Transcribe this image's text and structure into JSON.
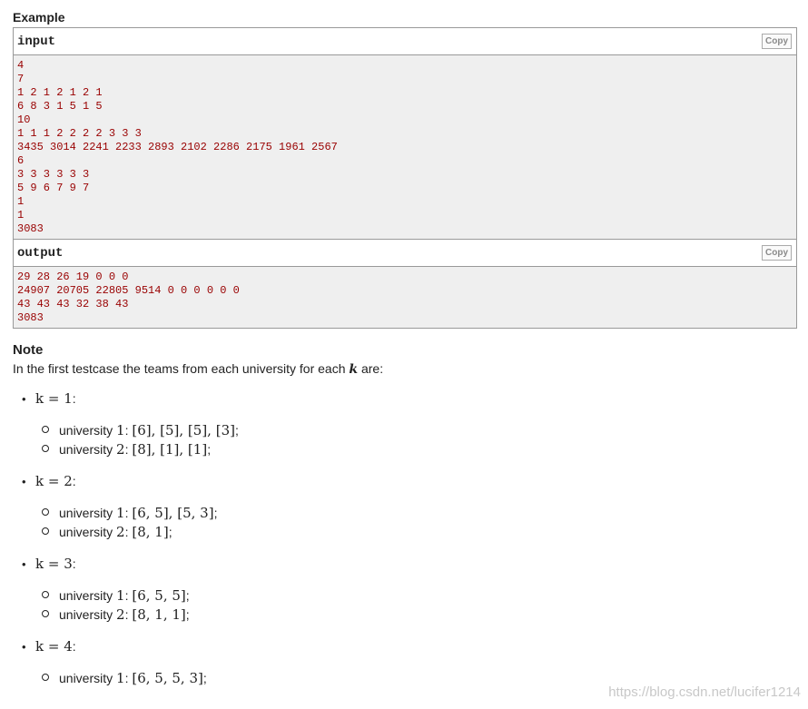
{
  "example": {
    "title": "Example",
    "input_label": "input",
    "output_label": "output",
    "copy_label": "Copy",
    "input_lines": [
      "4",
      "7",
      "1 2 1 2 1 2 1",
      "6 8 3 1 5 1 5",
      "10",
      "1 1 1 2 2 2 2 3 3 3",
      "3435 3014 2241 2233 2893 2102 2286 2175 1961 2567",
      "6",
      "3 3 3 3 3 3",
      "5 9 6 7 9 7",
      "1",
      "1",
      "3083"
    ],
    "output_lines": [
      "29 28 26 19 0 0 0",
      "24907 20705 22805 9514 0 0 0 0 0 0",
      "43 43 43 32 38 43",
      "3083"
    ]
  },
  "note": {
    "title": "Note",
    "intro_before": "In the first testcase the teams from each university for each ",
    "intro_var": "k",
    "intro_after": " are:",
    "cases": [
      {
        "k": "k = 1",
        "items": [
          {
            "label": "university ",
            "num": "1",
            "value": "[6], [5], [5], [3]"
          },
          {
            "label": "university ",
            "num": "2",
            "value": "[8], [1], [1]"
          }
        ]
      },
      {
        "k": "k = 2",
        "items": [
          {
            "label": "university ",
            "num": "1",
            "value": "[6, 5], [5, 3]"
          },
          {
            "label": "university ",
            "num": "2",
            "value": "[8, 1]"
          }
        ]
      },
      {
        "k": "k = 3",
        "items": [
          {
            "label": "university ",
            "num": "1",
            "value": "[6, 5, 5]"
          },
          {
            "label": "university ",
            "num": "2",
            "value": "[8, 1, 1]"
          }
        ]
      },
      {
        "k": "k = 4",
        "items": [
          {
            "label": "university ",
            "num": "1",
            "value": "[6, 5, 5, 3]"
          }
        ]
      }
    ]
  },
  "watermark": "https://blog.csdn.net/lucifer1214"
}
